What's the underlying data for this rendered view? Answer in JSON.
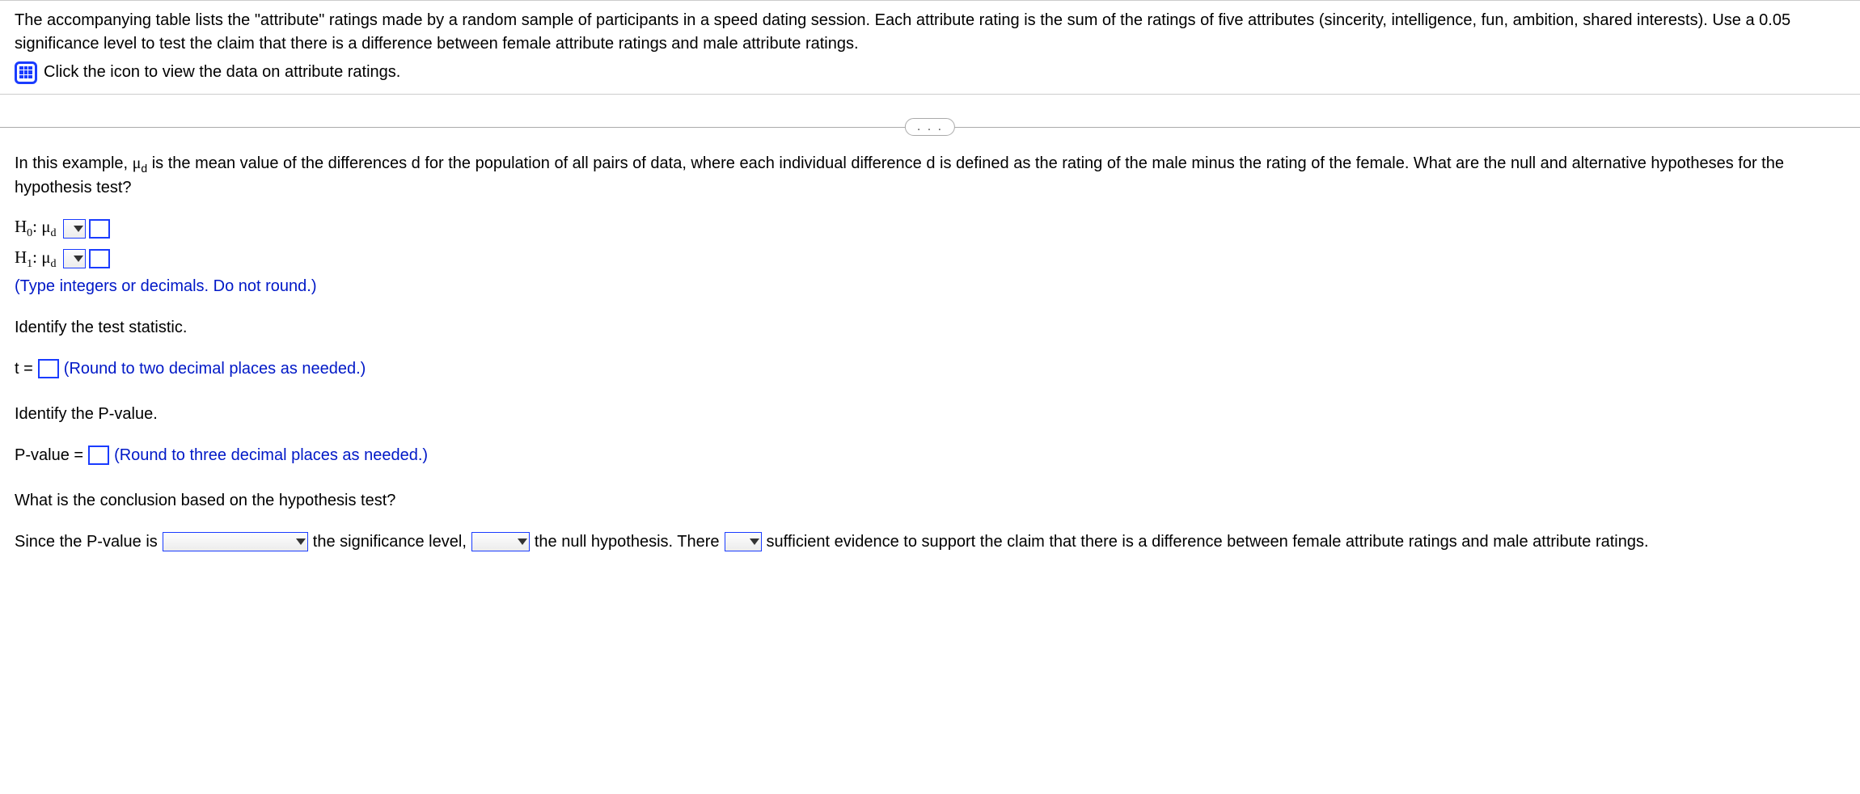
{
  "top": {
    "paragraph": "The accompanying table lists the \"attribute\" ratings made by a random sample of participants in a speed dating session. Each attribute rating is the sum of the ratings of five attributes (sincerity, intelligence, fun, ambition, shared interests). Use a 0.05 significance level to test the claim that there is a difference between female attribute ratings and male attribute ratings.",
    "icon_text": "Click the icon to view the data on attribute ratings."
  },
  "divider": {
    "dots": ". . ."
  },
  "body": {
    "intro_pre": "In this example, ",
    "mu_d": "μ",
    "sub_d": "d",
    "intro_post": " is the mean value of the differences d for the population of all pairs of data, where each individual difference d is defined as the rating of the male minus the rating of the female. What are the null and alternative hypotheses for the hypothesis test?",
    "h0_pre": "H",
    "h0_sub": "0",
    "h1_pre": "H",
    "h1_sub": "1",
    "h_colon_mu": ": μ",
    "hyp_hint": "(Type integers or decimals. Do not round.)",
    "identify_t": "Identify the test statistic.",
    "t_equals": "t = ",
    "t_hint": "(Round to two decimal places as needed.)",
    "identify_p": "Identify the P-value.",
    "p_equals": "P-value = ",
    "p_hint": "(Round to three decimal places as needed.)",
    "conclusion_q": "What is the conclusion based on the hypothesis test?",
    "conc_1": "Since the P-value is",
    "conc_2": "the significance level,",
    "conc_3": "the null hypothesis. There",
    "conc_4": "sufficient evidence to support the claim that there is a difference between female attribute ratings and male attribute ratings."
  }
}
